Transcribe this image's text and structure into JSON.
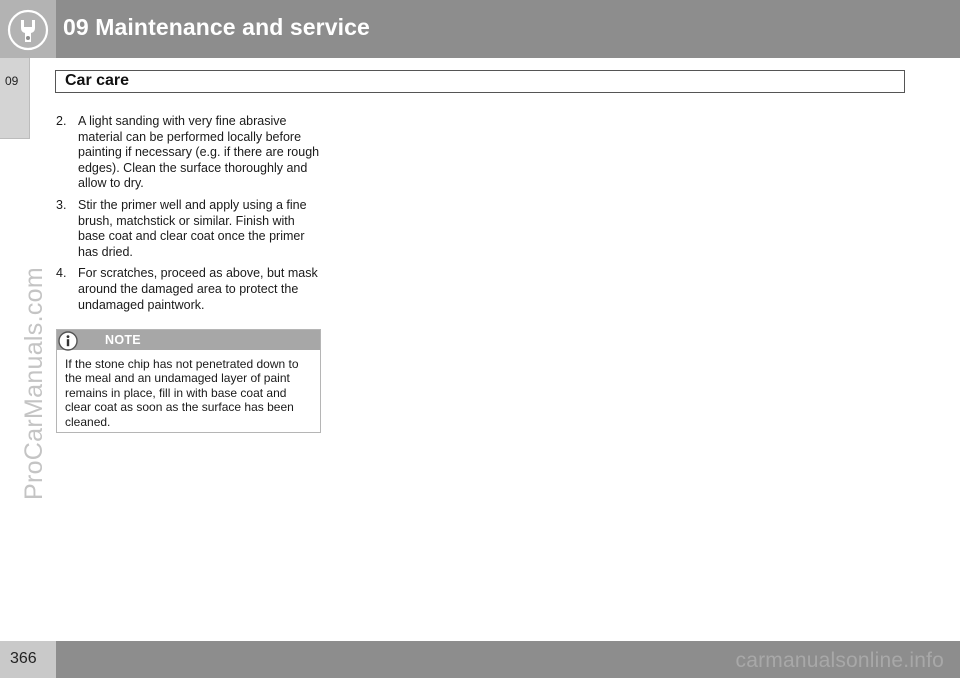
{
  "header": {
    "chapter_title": "09 Maintenance and service",
    "icon": "wrench-icon"
  },
  "side_tab": {
    "label": "09"
  },
  "section": {
    "title": "Car care"
  },
  "steps": [
    {
      "num": "2.",
      "text": "A light sanding with very fine abrasive material can be performed locally before painting if necessary (e.g. if there are rough edges). Clean the surface thoroughly and allow to dry."
    },
    {
      "num": "3.",
      "text": "Stir the primer well and apply using a fine brush, matchstick or similar. Finish with base coat and clear coat once the primer has dried."
    },
    {
      "num": "4.",
      "text": "For scratches, proceed as above, but mask around the damaged area to protect the undamaged paintwork."
    }
  ],
  "note": {
    "label": "NOTE",
    "icon": "info-icon",
    "text": "If the stone chip has not penetrated down to the meal and an undamaged layer of paint remains in place, fill in with base coat and clear coat as soon as the surface has been cleaned."
  },
  "watermark": "ProCarManuals.com",
  "footer": {
    "page_number": "366",
    "watermark": "carmanualsonline.info"
  }
}
